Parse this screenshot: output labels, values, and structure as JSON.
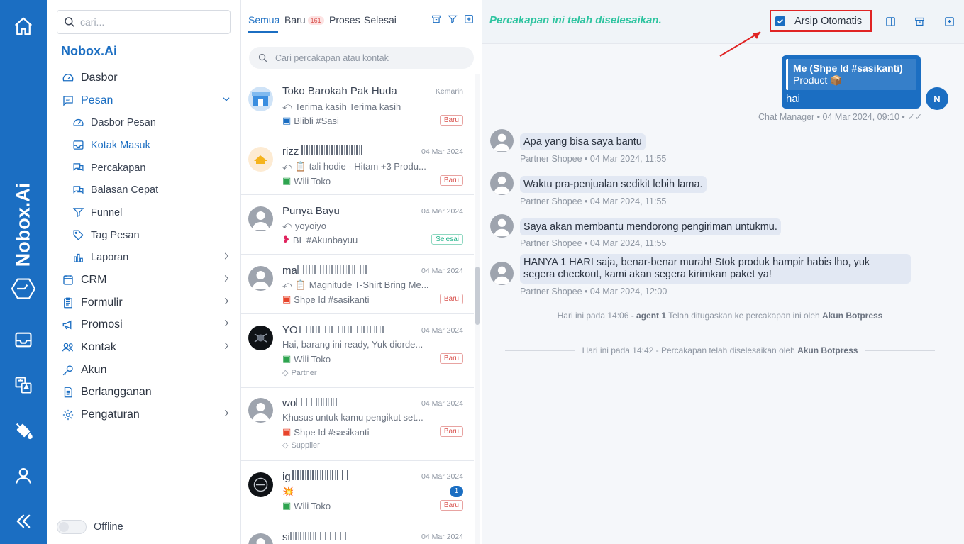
{
  "app": {
    "brand": "Nobox.Ai"
  },
  "rail": {
    "brand_text": "Nobox.Ai",
    "icons": [
      "home-icon",
      "brand-logo-icon",
      "inbox-icon",
      "translate-icon",
      "paint-bucket-icon",
      "user-icon",
      "collapse-icon"
    ]
  },
  "sidebar": {
    "search_placeholder": "cari...",
    "org_name": "Nobox.Ai",
    "items": [
      {
        "label": "Dasbor"
      },
      {
        "label": "Pesan"
      },
      {
        "label": "Dasbor Pesan"
      },
      {
        "label": "Kotak Masuk"
      },
      {
        "label": "Percakapan"
      },
      {
        "label": "Balasan Cepat"
      },
      {
        "label": "Funnel"
      },
      {
        "label": "Tag Pesan"
      },
      {
        "label": "Laporan"
      },
      {
        "label": "CRM"
      },
      {
        "label": "Formulir"
      },
      {
        "label": "Promosi"
      },
      {
        "label": "Kontak"
      },
      {
        "label": "Akun"
      },
      {
        "label": "Berlangganan"
      },
      {
        "label": "Pengaturan"
      }
    ],
    "status_label": "Offline"
  },
  "conv_panel": {
    "tabs": [
      {
        "label": "Semua"
      },
      {
        "label": "Baru",
        "count": "161"
      },
      {
        "label": "Proses"
      },
      {
        "label": "Selesai"
      }
    ],
    "search_placeholder": "Cari percakapan atau kontak",
    "conversations": [
      {
        "name": "Toko Barokah Pak Huda",
        "date": "Kemarin",
        "last": "Terima kasih Terima kasih",
        "channel": "Blibli #Sasi",
        "tag": "",
        "status": "Baru"
      },
      {
        "name": "rizz",
        "date": "04 Mar 2024",
        "last": "📋 tali hodie - Hitam +3 Produ...",
        "channel": "Wili Toko",
        "tag": "",
        "status": "Baru"
      },
      {
        "name": "Punya Bayu",
        "date": "04 Mar 2024",
        "last": "yoyoiyo",
        "channel": "BL #Akunbayuu",
        "tag": "",
        "status": "Selesai"
      },
      {
        "name": "ma",
        "date": "04 Mar 2024",
        "last": "📋 Magnitude T-Shirt Bring Me...",
        "channel": "Shpe Id #sasikanti",
        "tag": "",
        "status": "Baru"
      },
      {
        "name": "YO",
        "date": "04 Mar 2024",
        "last": "Hai, barang ini ready, Yuk diorde...",
        "channel": "Wili Toko",
        "tag": "Partner",
        "status": "Baru"
      },
      {
        "name": "wo",
        "date": "04 Mar 2024",
        "last": "Khusus untuk kamu pengikut set...",
        "channel": "Shpe Id #sasikanti",
        "tag": "Supplier",
        "status": "Baru"
      },
      {
        "name": "ig",
        "date": "04 Mar 2024",
        "last": "💥",
        "channel": "Wili Toko",
        "tag": "",
        "status": "Baru",
        "unread": "1"
      },
      {
        "name": "si",
        "date": "04 Mar 2024",
        "last": "",
        "channel": "",
        "tag": "",
        "status": ""
      }
    ]
  },
  "chat": {
    "resolved_banner": "Percakapan ini telah diselesaikan.",
    "auto_archive_label": "Arsip Otomatis",
    "auto_archive_checked": true,
    "outgoing": {
      "quote_title": "Me (Shpe Id #sasikanti)",
      "quote_sub": "Product 📦",
      "text": "hai",
      "meta": "Chat Manager • 04 Mar 2024, 09:10 •",
      "avatar_initial": "N"
    },
    "incoming": [
      {
        "text": "Apa yang bisa saya bantu",
        "meta": "Partner Shopee • 04 Mar 2024, 11:55"
      },
      {
        "text": "Waktu pra-penjualan sedikit lebih lama.",
        "meta": "Partner Shopee • 04 Mar 2024, 11:55"
      },
      {
        "text": "Saya akan membantu mendorong pengiriman untukmu.",
        "meta": "Partner Shopee • 04 Mar 2024, 11:55"
      },
      {
        "text": "HANYA 1 HARI saja, benar-benar murah! Stok produk hampir habis lho, yuk",
        "text2": "segera checkout, kami akan segera kirimkan paket ya!",
        "meta": "Partner Shopee • 04 Mar 2024, 12:00"
      }
    ],
    "system": [
      {
        "pre": "Hari ini pada 14:06 - ",
        "b1": "agent 1",
        "mid": " Telah ditugaskan ke percakapan ini oleh ",
        "b2": "Akun Botpress"
      },
      {
        "pre": "Hari ini pada 14:42 - Percakapan telah diselesaikan oleh ",
        "b1": "",
        "mid": "",
        "b2": "Akun Botpress"
      }
    ]
  },
  "colors": {
    "primary": "#1b6ec2",
    "success": "#2ec4a0",
    "danger": "#e02424"
  }
}
